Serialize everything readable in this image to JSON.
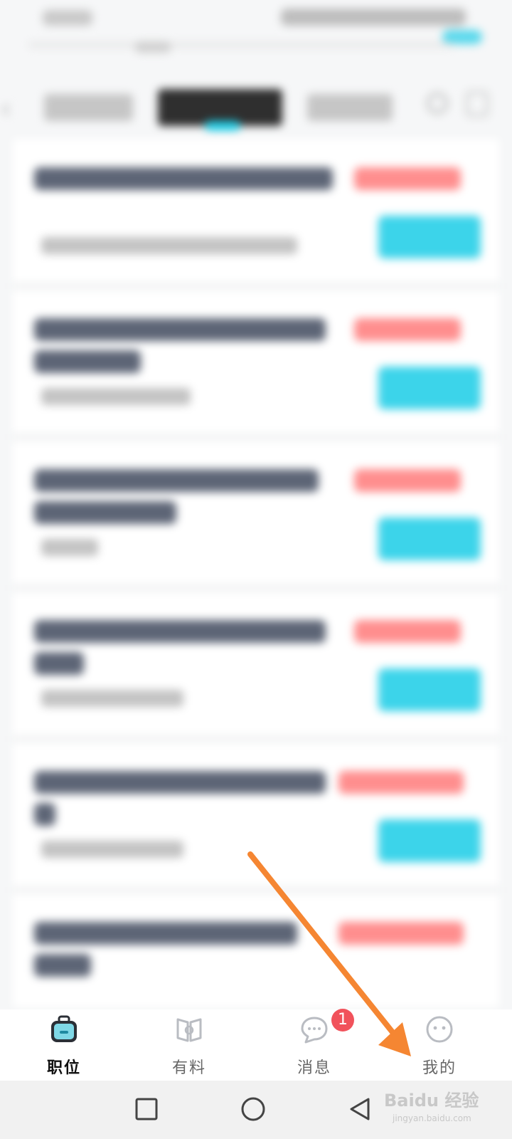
{
  "bottom_nav": {
    "items": [
      {
        "label": "职位",
        "icon": "briefcase-icon",
        "active": true
      },
      {
        "label": "有料",
        "icon": "book-icon",
        "active": false
      },
      {
        "label": "消息",
        "icon": "chat-icon",
        "active": false
      },
      {
        "label": "我的",
        "icon": "profile-icon",
        "active": false
      }
    ],
    "message_badge": "1"
  },
  "colors": {
    "accent": "#22cfe8",
    "price": "#ff8e8e",
    "annotation_arrow": "#f58632",
    "badge": "#f1525b"
  }
}
